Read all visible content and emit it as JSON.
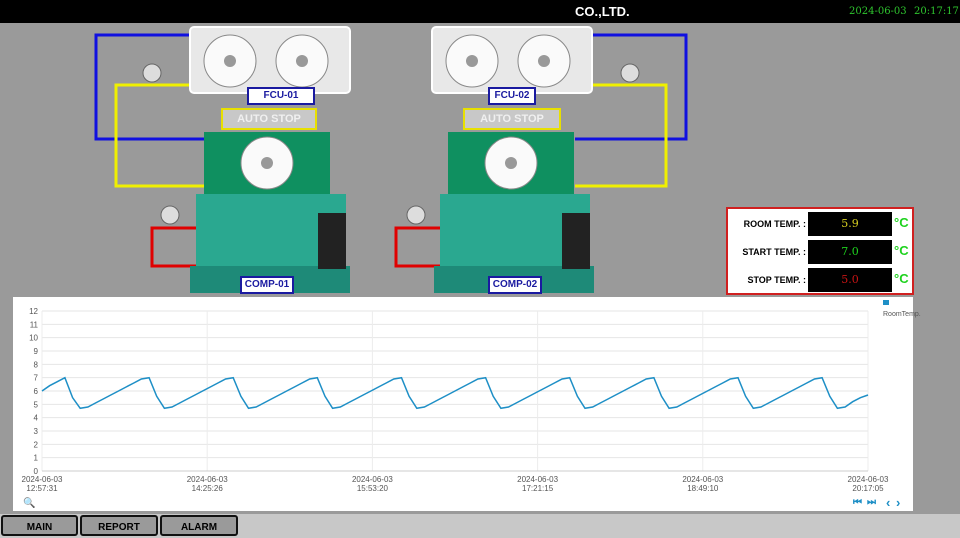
{
  "header": {
    "company": "CO.,LTD.",
    "date": "2024-06-03",
    "time": "20:17:17"
  },
  "units": [
    {
      "fcu": "FCU-01",
      "status": "AUTO STOP",
      "comp": "COMP-01"
    },
    {
      "fcu": "FCU-02",
      "status": "AUTO STOP",
      "comp": "COMP-02"
    }
  ],
  "temps": {
    "room": {
      "label": "ROOM TEMP. :",
      "value": "5.9",
      "color": "#d8d020"
    },
    "start": {
      "label": "START TEMP. :",
      "value": "7.0",
      "color": "#1ed21e"
    },
    "stop": {
      "label": "STOP TEMP. :",
      "value": "5.0",
      "color": "#c81414"
    },
    "unit": "°C"
  },
  "chart_data": {
    "type": "line",
    "title": "",
    "series": [
      {
        "name": "RoomTemp.",
        "color": "#1e8fc6",
        "values": [
          6.0,
          6.4,
          6.7,
          7.0,
          5.5,
          4.7,
          4.8,
          5.1,
          5.4,
          5.7,
          6.0,
          6.3,
          6.6,
          6.9,
          7.0,
          5.6,
          4.7,
          4.8,
          5.1,
          5.4,
          5.7,
          6.0,
          6.3,
          6.6,
          6.9,
          7.0,
          5.6,
          4.7,
          4.8,
          5.1,
          5.4,
          5.7,
          6.0,
          6.3,
          6.6,
          6.9,
          7.0,
          5.6,
          4.7,
          4.8,
          5.1,
          5.4,
          5.7,
          6.0,
          6.3,
          6.6,
          6.9,
          7.0,
          5.6,
          4.7,
          4.8,
          5.1,
          5.4,
          5.7,
          6.0,
          6.3,
          6.6,
          6.9,
          7.0,
          5.6,
          4.7,
          4.8,
          5.1,
          5.4,
          5.7,
          6.0,
          6.3,
          6.6,
          6.9,
          7.0,
          5.6,
          4.7,
          4.8,
          5.1,
          5.4,
          5.7,
          6.0,
          6.3,
          6.6,
          6.9,
          7.0,
          5.6,
          4.7,
          4.8,
          5.1,
          5.4,
          5.7,
          6.0,
          6.3,
          6.6,
          6.9,
          7.0,
          5.6,
          4.7,
          4.8,
          5.1,
          5.4,
          5.7,
          6.0,
          6.3,
          6.6,
          6.9,
          7.0,
          5.6,
          4.7,
          4.8,
          5.2,
          5.5,
          5.7
        ]
      }
    ],
    "ylim": [
      0,
      12
    ],
    "yticks": [
      "0",
      "1",
      "2",
      "3",
      "4",
      "5",
      "6",
      "7",
      "8",
      "9",
      "10",
      "11",
      "12"
    ],
    "xticks": [
      [
        "2024-06-03",
        "12:57:31"
      ],
      [
        "2024-06-03",
        "14:25:26"
      ],
      [
        "2024-06-03",
        "15:53:20"
      ],
      [
        "2024-06-03",
        "17:21:15"
      ],
      [
        "2024-06-03",
        "18:49:10"
      ],
      [
        "2024-06-03",
        "20:17:05"
      ]
    ],
    "grid": true,
    "legend": "top-right"
  },
  "legend_label": "RoomTemp.",
  "nav": {
    "main": "MAIN",
    "report": "REPORT",
    "alarm": "ALARM"
  },
  "controls": {
    "zoom": "🔍",
    "first": "⏮",
    "last": "⏭",
    "prev": "‹",
    "next": "›"
  }
}
